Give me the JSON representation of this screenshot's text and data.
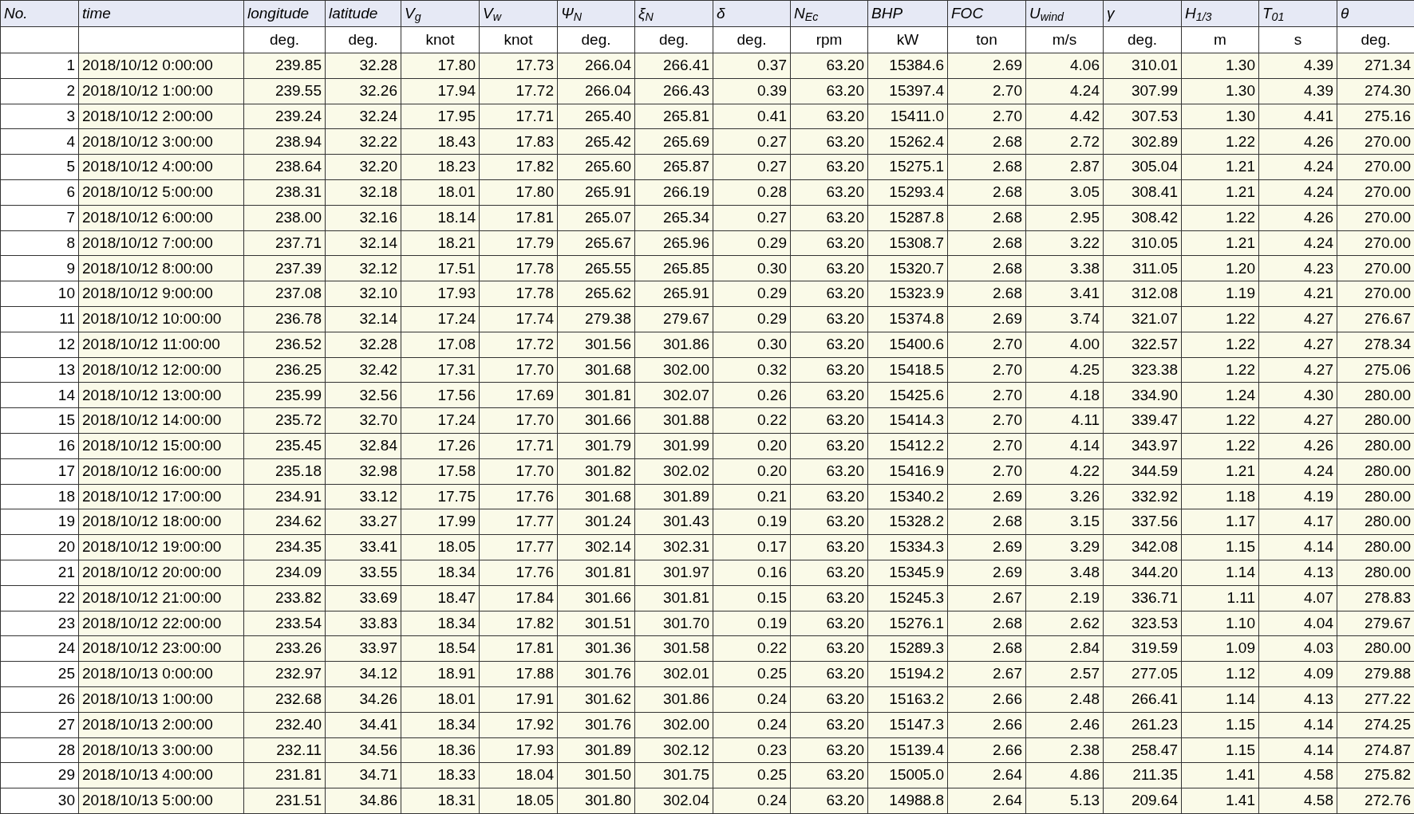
{
  "table": {
    "columns": [
      "No.",
      "time",
      "longitude",
      "latitude",
      "V$_{g}$",
      "V$_{w}$",
      "Ψ$_{N}$",
      "ξ$_{N}$",
      "δ",
      "N$_{Ec}$",
      "BHP",
      "FOC",
      "U$_{wind}$",
      "γ",
      "H$_{1/3}$",
      "T$_{01}$",
      "θ"
    ],
    "units": [
      "deg.",
      "deg.",
      "knot",
      "knot",
      "deg.",
      "deg.",
      "deg.",
      "rpm",
      "kW",
      "ton",
      "m/s",
      "deg.",
      "m",
      "s",
      "deg."
    ],
    "rows": [
      [
        "1",
        "2018/10/12 0:00:00",
        "239.85",
        "32.28",
        "17.80",
        "17.73",
        "266.04",
        "266.41",
        "0.37",
        "63.20",
        "15384.6",
        "2.69",
        "4.06",
        "310.01",
        "1.30",
        "4.39",
        "271.34"
      ],
      [
        "2",
        "2018/10/12 1:00:00",
        "239.55",
        "32.26",
        "17.94",
        "17.72",
        "266.04",
        "266.43",
        "0.39",
        "63.20",
        "15397.4",
        "2.70",
        "4.24",
        "307.99",
        "1.30",
        "4.39",
        "274.30"
      ],
      [
        "3",
        "2018/10/12 2:00:00",
        "239.24",
        "32.24",
        "17.95",
        "17.71",
        "265.40",
        "265.81",
        "0.41",
        "63.20",
        "15411.0",
        "2.70",
        "4.42",
        "307.53",
        "1.30",
        "4.41",
        "275.16"
      ],
      [
        "4",
        "2018/10/12 3:00:00",
        "238.94",
        "32.22",
        "18.43",
        "17.83",
        "265.42",
        "265.69",
        "0.27",
        "63.20",
        "15262.4",
        "2.68",
        "2.72",
        "302.89",
        "1.22",
        "4.26",
        "270.00"
      ],
      [
        "5",
        "2018/10/12 4:00:00",
        "238.64",
        "32.20",
        "18.23",
        "17.82",
        "265.60",
        "265.87",
        "0.27",
        "63.20",
        "15275.1",
        "2.68",
        "2.87",
        "305.04",
        "1.21",
        "4.24",
        "270.00"
      ],
      [
        "6",
        "2018/10/12 5:00:00",
        "238.31",
        "32.18",
        "18.01",
        "17.80",
        "265.91",
        "266.19",
        "0.28",
        "63.20",
        "15293.4",
        "2.68",
        "3.05",
        "308.41",
        "1.21",
        "4.24",
        "270.00"
      ],
      [
        "7",
        "2018/10/12 6:00:00",
        "238.00",
        "32.16",
        "18.14",
        "17.81",
        "265.07",
        "265.34",
        "0.27",
        "63.20",
        "15287.8",
        "2.68",
        "2.95",
        "308.42",
        "1.22",
        "4.26",
        "270.00"
      ],
      [
        "8",
        "2018/10/12 7:00:00",
        "237.71",
        "32.14",
        "18.21",
        "17.79",
        "265.67",
        "265.96",
        "0.29",
        "63.20",
        "15308.7",
        "2.68",
        "3.22",
        "310.05",
        "1.21",
        "4.24",
        "270.00"
      ],
      [
        "9",
        "2018/10/12 8:00:00",
        "237.39",
        "32.12",
        "17.51",
        "17.78",
        "265.55",
        "265.85",
        "0.30",
        "63.20",
        "15320.7",
        "2.68",
        "3.38",
        "311.05",
        "1.20",
        "4.23",
        "270.00"
      ],
      [
        "10",
        "2018/10/12 9:00:00",
        "237.08",
        "32.10",
        "17.93",
        "17.78",
        "265.62",
        "265.91",
        "0.29",
        "63.20",
        "15323.9",
        "2.68",
        "3.41",
        "312.08",
        "1.19",
        "4.21",
        "270.00"
      ],
      [
        "11",
        "2018/10/12 10:00:00",
        "236.78",
        "32.14",
        "17.24",
        "17.74",
        "279.38",
        "279.67",
        "0.29",
        "63.20",
        "15374.8",
        "2.69",
        "3.74",
        "321.07",
        "1.22",
        "4.27",
        "276.67"
      ],
      [
        "12",
        "2018/10/12 11:00:00",
        "236.52",
        "32.28",
        "17.08",
        "17.72",
        "301.56",
        "301.86",
        "0.30",
        "63.20",
        "15400.6",
        "2.70",
        "4.00",
        "322.57",
        "1.22",
        "4.27",
        "278.34"
      ],
      [
        "13",
        "2018/10/12 12:00:00",
        "236.25",
        "32.42",
        "17.31",
        "17.70",
        "301.68",
        "302.00",
        "0.32",
        "63.20",
        "15418.5",
        "2.70",
        "4.25",
        "323.38",
        "1.22",
        "4.27",
        "275.06"
      ],
      [
        "14",
        "2018/10/12 13:00:00",
        "235.99",
        "32.56",
        "17.56",
        "17.69",
        "301.81",
        "302.07",
        "0.26",
        "63.20",
        "15425.6",
        "2.70",
        "4.18",
        "334.90",
        "1.24",
        "4.30",
        "280.00"
      ],
      [
        "15",
        "2018/10/12 14:00:00",
        "235.72",
        "32.70",
        "17.24",
        "17.70",
        "301.66",
        "301.88",
        "0.22",
        "63.20",
        "15414.3",
        "2.70",
        "4.11",
        "339.47",
        "1.22",
        "4.27",
        "280.00"
      ],
      [
        "16",
        "2018/10/12 15:00:00",
        "235.45",
        "32.84",
        "17.26",
        "17.71",
        "301.79",
        "301.99",
        "0.20",
        "63.20",
        "15412.2",
        "2.70",
        "4.14",
        "343.97",
        "1.22",
        "4.26",
        "280.00"
      ],
      [
        "17",
        "2018/10/12 16:00:00",
        "235.18",
        "32.98",
        "17.58",
        "17.70",
        "301.82",
        "302.02",
        "0.20",
        "63.20",
        "15416.9",
        "2.70",
        "4.22",
        "344.59",
        "1.21",
        "4.24",
        "280.00"
      ],
      [
        "18",
        "2018/10/12 17:00:00",
        "234.91",
        "33.12",
        "17.75",
        "17.76",
        "301.68",
        "301.89",
        "0.21",
        "63.20",
        "15340.2",
        "2.69",
        "3.26",
        "332.92",
        "1.18",
        "4.19",
        "280.00"
      ],
      [
        "19",
        "2018/10/12 18:00:00",
        "234.62",
        "33.27",
        "17.99",
        "17.77",
        "301.24",
        "301.43",
        "0.19",
        "63.20",
        "15328.2",
        "2.68",
        "3.15",
        "337.56",
        "1.17",
        "4.17",
        "280.00"
      ],
      [
        "20",
        "2018/10/12 19:00:00",
        "234.35",
        "33.41",
        "18.05",
        "17.77",
        "302.14",
        "302.31",
        "0.17",
        "63.20",
        "15334.3",
        "2.69",
        "3.29",
        "342.08",
        "1.15",
        "4.14",
        "280.00"
      ],
      [
        "21",
        "2018/10/12 20:00:00",
        "234.09",
        "33.55",
        "18.34",
        "17.76",
        "301.81",
        "301.97",
        "0.16",
        "63.20",
        "15345.9",
        "2.69",
        "3.48",
        "344.20",
        "1.14",
        "4.13",
        "280.00"
      ],
      [
        "22",
        "2018/10/12 21:00:00",
        "233.82",
        "33.69",
        "18.47",
        "17.84",
        "301.66",
        "301.81",
        "0.15",
        "63.20",
        "15245.3",
        "2.67",
        "2.19",
        "336.71",
        "1.11",
        "4.07",
        "278.83"
      ],
      [
        "23",
        "2018/10/12 22:00:00",
        "233.54",
        "33.83",
        "18.34",
        "17.82",
        "301.51",
        "301.70",
        "0.19",
        "63.20",
        "15276.1",
        "2.68",
        "2.62",
        "323.53",
        "1.10",
        "4.04",
        "279.67"
      ],
      [
        "24",
        "2018/10/12 23:00:00",
        "233.26",
        "33.97",
        "18.54",
        "17.81",
        "301.36",
        "301.58",
        "0.22",
        "63.20",
        "15289.3",
        "2.68",
        "2.84",
        "319.59",
        "1.09",
        "4.03",
        "280.00"
      ],
      [
        "25",
        "2018/10/13 0:00:00",
        "232.97",
        "34.12",
        "18.91",
        "17.88",
        "301.76",
        "302.01",
        "0.25",
        "63.20",
        "15194.2",
        "2.67",
        "2.57",
        "277.05",
        "1.12",
        "4.09",
        "279.88"
      ],
      [
        "26",
        "2018/10/13 1:00:00",
        "232.68",
        "34.26",
        "18.01",
        "17.91",
        "301.62",
        "301.86",
        "0.24",
        "63.20",
        "15163.2",
        "2.66",
        "2.48",
        "266.41",
        "1.14",
        "4.13",
        "277.22"
      ],
      [
        "27",
        "2018/10/13 2:00:00",
        "232.40",
        "34.41",
        "18.34",
        "17.92",
        "301.76",
        "302.00",
        "0.24",
        "63.20",
        "15147.3",
        "2.66",
        "2.46",
        "261.23",
        "1.15",
        "4.14",
        "274.25"
      ],
      [
        "28",
        "2018/10/13 3:00:00",
        "232.11",
        "34.56",
        "18.36",
        "17.93",
        "301.89",
        "302.12",
        "0.23",
        "63.20",
        "15139.4",
        "2.66",
        "2.38",
        "258.47",
        "1.15",
        "4.14",
        "274.87"
      ],
      [
        "29",
        "2018/10/13 4:00:00",
        "231.81",
        "34.71",
        "18.33",
        "18.04",
        "301.50",
        "301.75",
        "0.25",
        "63.20",
        "15005.0",
        "2.64",
        "4.86",
        "211.35",
        "1.41",
        "4.58",
        "275.82"
      ],
      [
        "30",
        "2018/10/13 5:00:00",
        "231.51",
        "34.86",
        "18.31",
        "18.05",
        "301.80",
        "302.04",
        "0.24",
        "63.20",
        "14988.8",
        "2.64",
        "5.13",
        "209.64",
        "1.41",
        "4.58",
        "272.76"
      ]
    ]
  }
}
